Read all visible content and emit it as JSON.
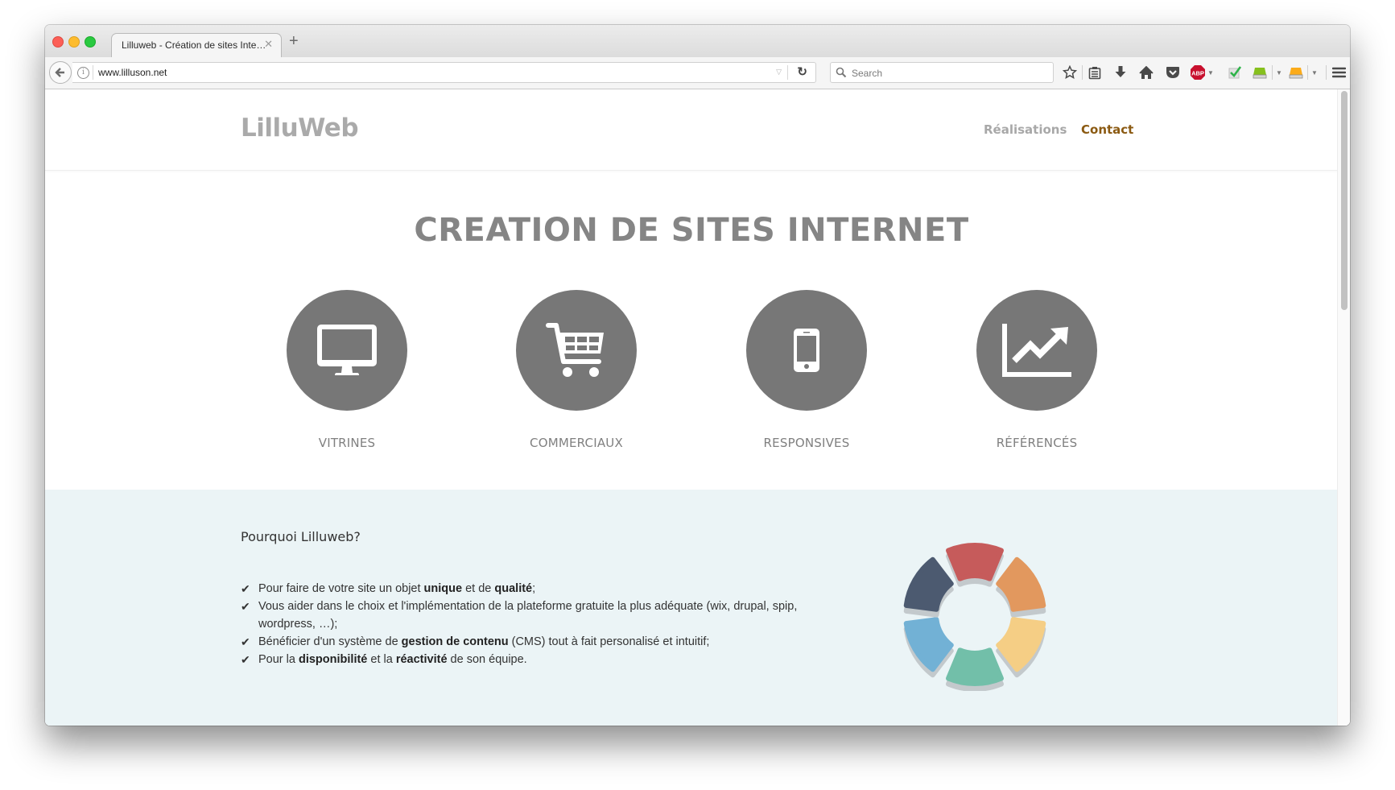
{
  "browser": {
    "tab": {
      "title": "Lilluweb - Création de sites Inte…"
    },
    "new_tab_label": "+",
    "url": "www.lilluson.net",
    "search_placeholder": "Search",
    "toolbar_icons": [
      "bookmark-star-icon",
      "reading-list-icon",
      "download-icon",
      "home-icon",
      "pocket-icon",
      "adblock-plus-icon",
      "checkmark-extension-icon",
      "green-drive-icon",
      "orange-drive-icon",
      "hamburger-menu-icon"
    ],
    "adblock_label": "ABP"
  },
  "site": {
    "logo": "LilluWeb",
    "nav": [
      {
        "label": "Réalisations",
        "color": "#a8a8a8"
      },
      {
        "label": "Contact",
        "color": "#8b5a12"
      }
    ],
    "title": "CREATION DE SITES INTERNET",
    "features": [
      {
        "label": "VITRINES",
        "icon": "desktop-monitor-icon"
      },
      {
        "label": "COMMERCIAUX",
        "icon": "shopping-cart-icon"
      },
      {
        "label": "RESPONSIVES",
        "icon": "mobile-phone-icon"
      },
      {
        "label": "RÉFÉRENCÉS",
        "icon": "trending-chart-icon"
      }
    ],
    "why": {
      "title": "Pourquoi Lilluweb?",
      "items": [
        [
          {
            "t": "Pour faire de votre site un objet "
          },
          {
            "t": "unique",
            "b": true
          },
          {
            "t": " et de "
          },
          {
            "t": "qualité",
            "b": true
          },
          {
            "t": ";"
          }
        ],
        [
          {
            "t": "Vous aider dans le choix et l'implémentation de la plateforme gratuite la plus adéquate (wix, drupal, spip, wordpress, …);"
          }
        ],
        [
          {
            "t": "Bénéficier d'un système de "
          },
          {
            "t": "gestion de contenu",
            "b": true
          },
          {
            "t": " (CMS) tout à fait personalisé et intuitif;"
          }
        ],
        [
          {
            "t": "Pour la "
          },
          {
            "t": "disponibilité",
            "b": true
          },
          {
            "t": " et la "
          },
          {
            "t": "réactivité",
            "b": true
          },
          {
            "t": " de son équipe."
          }
        ]
      ]
    },
    "ring_colors": [
      "#c65b5b",
      "#e2985e",
      "#f5ce85",
      "#72bfa9",
      "#72b1d5",
      "#4c5a70"
    ]
  }
}
